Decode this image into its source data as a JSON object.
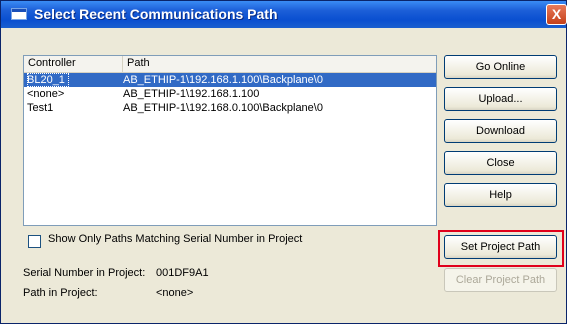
{
  "window": {
    "title": "Select Recent Communications Path",
    "close_label": "X"
  },
  "list": {
    "columns": [
      "Controller",
      "Path"
    ],
    "rows": [
      {
        "controller": "BL20_1",
        "path": "AB_ETHIP-1\\192.168.1.100\\Backplane\\0",
        "selected": true
      },
      {
        "controller": "<none>",
        "path": "AB_ETHIP-1\\192.168.1.100",
        "selected": false
      },
      {
        "controller": "Test1",
        "path": "AB_ETHIP-1\\192.168.0.100\\Backplane\\0",
        "selected": false
      }
    ]
  },
  "buttons": {
    "go_online": "Go Online",
    "upload": "Upload...",
    "download": "Download",
    "close": "Close",
    "help": "Help",
    "set_project_path": "Set Project Path",
    "clear_project_path": "Clear Project Path"
  },
  "filter": {
    "label": "Show Only Paths Matching Serial Number in Project",
    "checked": false
  },
  "info": {
    "serial_label": "Serial Number in Project:",
    "serial_value": "001DF9A1",
    "path_label": "Path in Project:",
    "path_value": "<none>"
  },
  "colors": {
    "titlebar": "#0a4fd0",
    "selection": "#316ac5",
    "highlight_box": "#e0001b"
  }
}
